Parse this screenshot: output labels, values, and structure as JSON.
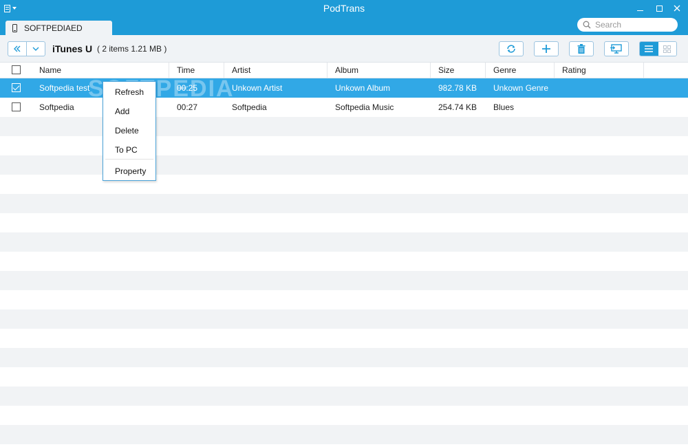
{
  "window": {
    "title": "PodTrans"
  },
  "device_tab": {
    "label": "SOFTPEDIAED"
  },
  "search": {
    "placeholder": "Search"
  },
  "toolbar": {
    "title": "iTunes U",
    "count": "( 2 items 1.21 MB )"
  },
  "table": {
    "columns": [
      "Name",
      "Time",
      "Artist",
      "Album",
      "Size",
      "Genre",
      "Rating"
    ],
    "rows": [
      {
        "checked": true,
        "name": "Softpedia test",
        "time": "00:25",
        "artist": "Unkown Artist",
        "album": "Unkown Album",
        "size": "982.78 KB",
        "genre": "Unkown Genre",
        "rating": ""
      },
      {
        "checked": false,
        "name": "Softpedia",
        "time": "00:27",
        "artist": "Softpedia",
        "album": "Softpedia Music",
        "size": "254.74 KB",
        "genre": "Blues",
        "rating": ""
      }
    ]
  },
  "context_menu": {
    "items": [
      "Refresh",
      "Add",
      "Delete",
      "To PC",
      "Property"
    ]
  },
  "colors": {
    "accent": "#1e9bd7",
    "selected_row": "#31a8e6",
    "alt_row": "#f1f3f5",
    "toolbar_bg": "#f0f3f6"
  },
  "watermark": "SOFTPEDIA"
}
